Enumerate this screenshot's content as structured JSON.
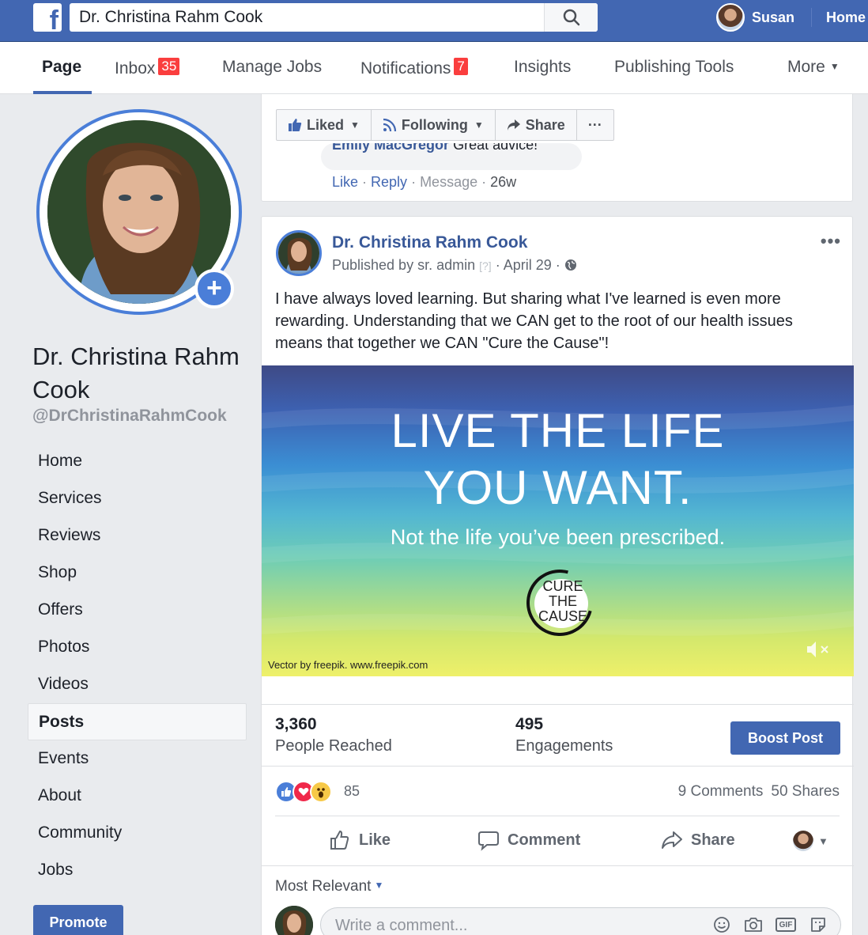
{
  "topbar": {
    "logo": "f",
    "search_value": "Dr. Christina Rahm Cook",
    "user_name": "Susan",
    "home_label": "Home"
  },
  "page_nav": {
    "items": [
      {
        "label": "Page",
        "badge": null
      },
      {
        "label": "Inbox",
        "badge": "35"
      },
      {
        "label": "Manage Jobs",
        "badge": null
      },
      {
        "label": "Notifications",
        "badge": "7"
      },
      {
        "label": "Insights",
        "badge": null
      },
      {
        "label": "Publishing Tools",
        "badge": null
      },
      {
        "label": "More",
        "badge": null
      }
    ]
  },
  "profile": {
    "name": "Dr. Christina Rahm Cook",
    "handle": "@DrChristinaRahmCook",
    "plus": "+"
  },
  "sidebar": {
    "items": [
      "Home",
      "Services",
      "Reviews",
      "Shop",
      "Offers",
      "Photos",
      "Videos",
      "Posts",
      "Events",
      "About",
      "Community",
      "Jobs"
    ],
    "active": "Posts",
    "promote_label": "Promote"
  },
  "page_actions": {
    "liked": "Liked",
    "following": "Following",
    "share": "Share",
    "more": "···"
  },
  "previous_comment": {
    "author": "Emily MacGregor",
    "text": "Great advice!",
    "like": "Like",
    "reply": "Reply",
    "message": "Message",
    "time": "26w"
  },
  "post": {
    "author": "Dr. Christina Rahm Cook",
    "published_by": "Published by sr. admin",
    "help": "[?]",
    "date": "April 29",
    "more": "•••",
    "text": "I have always loved learning. But sharing what I've learned is even more rewarding. Understanding that we CAN get to the root of our health issues means that together we CAN \"Cure the Cause\"!",
    "image": {
      "line1": "LIVE THE LIFE",
      "line2": "YOU WANT.",
      "line3": "Not the life you’ve been prescribed.",
      "logo_lines": [
        "CURE",
        "THE",
        "CAUSE"
      ],
      "credit": "Vector by freepik. www.freepik.com"
    },
    "stats": {
      "reached": "3,360",
      "reached_label": "People Reached",
      "engagements": "495",
      "engagements_label": "Engagements",
      "boost_label": "Boost Post"
    },
    "reactions_count": "85",
    "comments_count": "9 Comments",
    "shares_count": "50 Shares",
    "actions": {
      "like": "Like",
      "comment": "Comment",
      "share": "Share"
    },
    "sort_label": "Most Relevant",
    "comment_placeholder": "Write a comment..."
  },
  "colors": {
    "brand": "#4267b2",
    "badge": "#fa3e3e",
    "ring": "#4a7ed8"
  }
}
